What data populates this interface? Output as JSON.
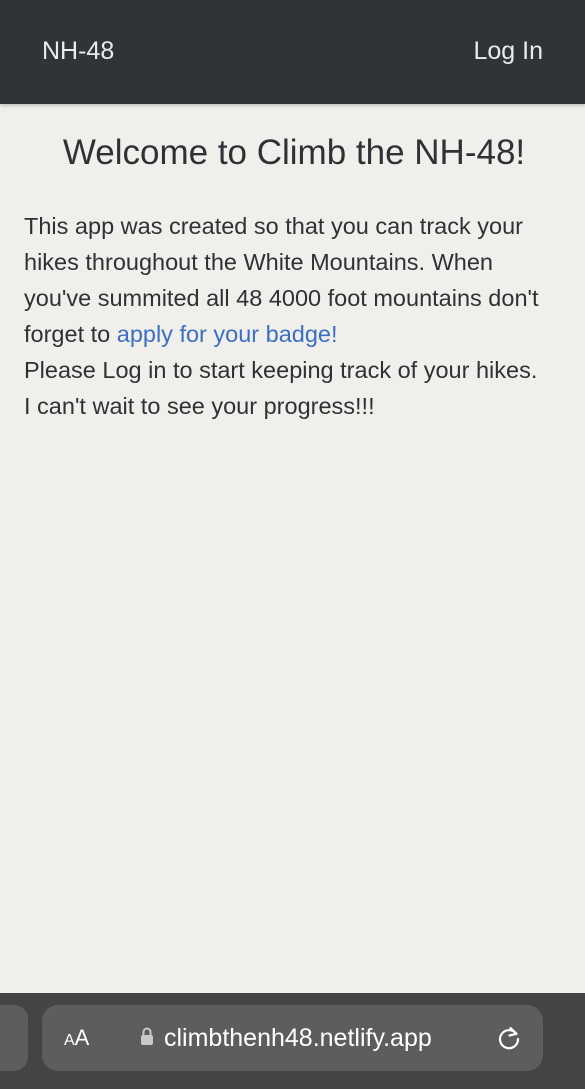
{
  "navbar": {
    "brand": "NH-48",
    "login": "Log In"
  },
  "main": {
    "title": "Welcome to Climb the NH-48!",
    "paragraph_before_link": "This app was created so that you can track your hikes throughout the White Mountains. When you've summited all 48 4000 foot mountains don't forget to ",
    "link_text": "apply for your badge!",
    "line2": "Please Log in to start keeping track of your hikes.",
    "line3": "I can't wait to see your progress!!!"
  },
  "browser": {
    "aa_label_small": "A",
    "aa_label_large": "A",
    "url": "climbthenh48.netlify.app",
    "icons": [
      "lock-icon",
      "reload-icon"
    ]
  },
  "colors": {
    "navbar_bg": "#2e3438",
    "page_bg": "#f0efeb",
    "link": "#3b6fc4",
    "toolbar_bg": "#434446"
  }
}
